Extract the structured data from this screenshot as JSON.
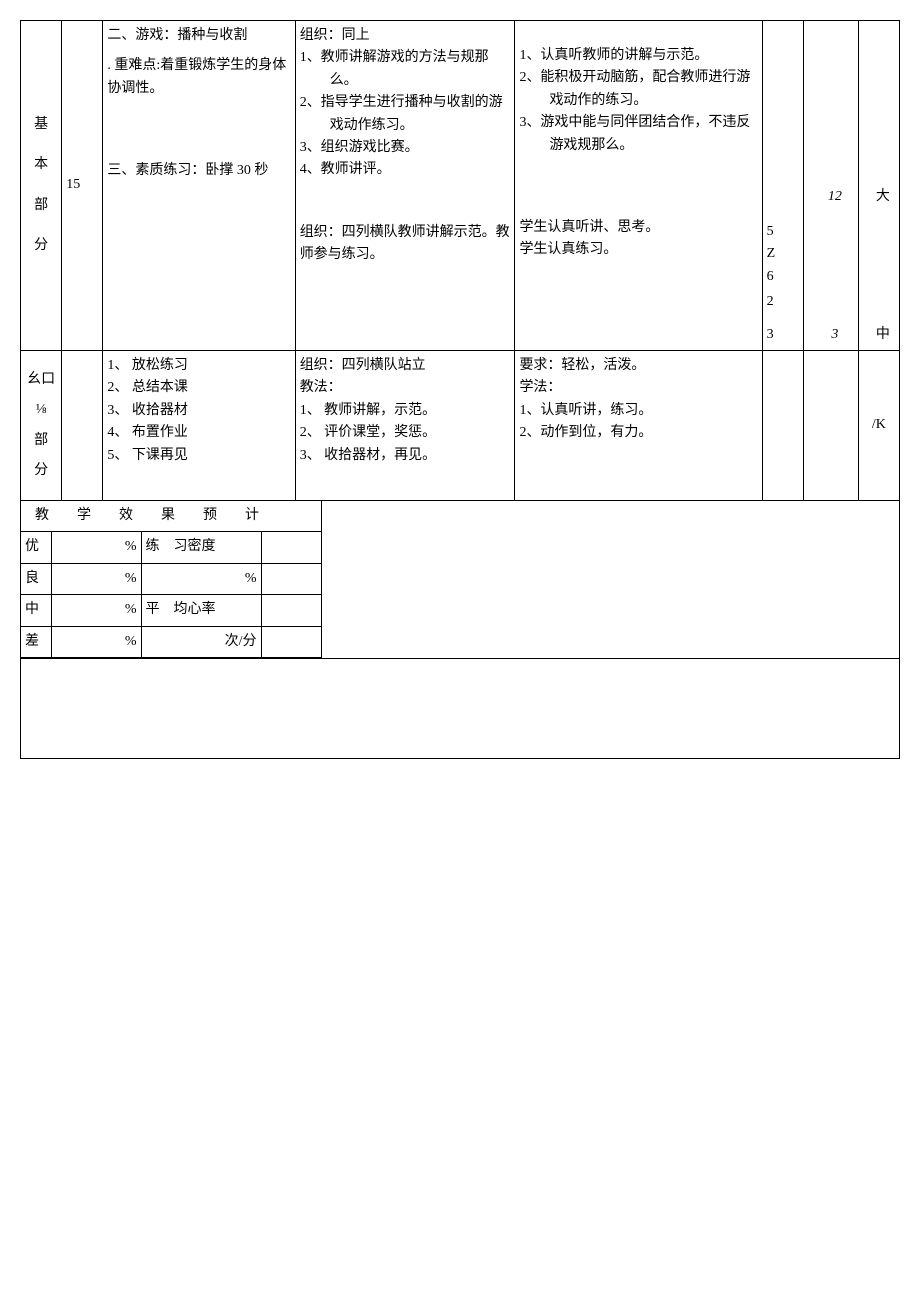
{
  "row1": {
    "section_label_chars": [
      "基",
      "本",
      "部",
      "分"
    ],
    "time": "15",
    "content": {
      "item2_title": "二、游戏：播种与收割",
      "item2_focus": ". 重难点:着重锻炼学生的身体协调性。",
      "item3_title": "三、素质练习：卧撑 30 秒"
    },
    "method": {
      "org1": "组织：同上",
      "m1": "1、教师讲解游戏的方法与规那么。",
      "m2": "2、指导学生进行播种与收割的游戏动作练习。",
      "m3": "3、组织游戏比赛。",
      "m4": "4、教师讲评。",
      "org2": "组织：四列横队教师讲解示范。教师参与练习。"
    },
    "student": {
      "s1": "1、认真听教师的讲解与示范。",
      "s2": "2、能积极开动脑筋，配合教师进行游戏动作的练习。",
      "s3": "3、游戏中能与同伴团结合作，不违反游戏规那么。",
      "s_bottom1": "学生认真听讲、思考。",
      "s_bottom2": "学生认真练习。"
    },
    "count_col": {
      "a": "5",
      "b": "Z",
      "c": "6",
      "d": "2",
      "e": "3"
    },
    "duration_top": "12",
    "duration_bottom": "3",
    "intensity_top": "大",
    "intensity_bottom": "中"
  },
  "row2": {
    "section_label_chars": [
      "幺口",
      "⅛",
      "部",
      "分"
    ],
    "content": {
      "c1": "1、 放松练习",
      "c2": "2、 总结本课",
      "c3": "3、 收拾器材",
      "c4": "4、 布置作业",
      "c5": "5、 下课再见"
    },
    "method": {
      "org": "组织：四列横队站立",
      "label": "教法：",
      "m1": "1、 教师讲解，示范。",
      "m2": "2、 评价课堂，奖惩。",
      "m3": "3、 收拾器材，再见。"
    },
    "student": {
      "req": "要求：轻松，活泼。",
      "label": "学法：",
      "s1": "1、认真听讲，练习。",
      "s2": "2、动作到位，有力。"
    },
    "intensity": "/K"
  },
  "bottom": {
    "title": "教　　学　　效　　果　　预　　计",
    "rows": {
      "r1_left": "优",
      "r1_pct": "%",
      "r1_mid": "练　习密度",
      "r2_left": "良",
      "r2_pct": "%",
      "r2_mid": "%",
      "r3_left": "中",
      "r3_pct": "%",
      "r3_mid": "平　均心率",
      "r4_left": "差",
      "r4_pct": "%",
      "r4_mid": "次/分"
    }
  }
}
